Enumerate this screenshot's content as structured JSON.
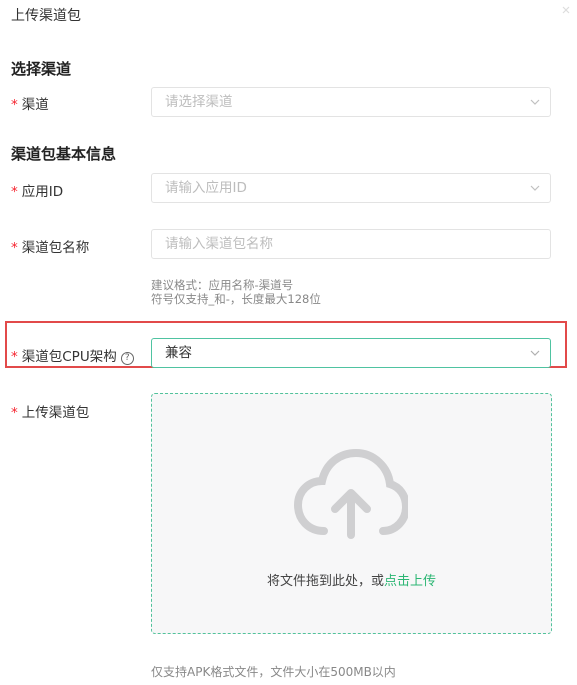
{
  "header": {
    "title": "上传渠道包"
  },
  "sections": {
    "select_channel": "选择渠道",
    "basic_info": "渠道包基本信息"
  },
  "fields": {
    "channel": {
      "required": "*",
      "label": "渠道",
      "placeholder": "请选择渠道"
    },
    "app_id": {
      "required": "*",
      "label": "应用ID",
      "placeholder": "请输入应用ID"
    },
    "package_name": {
      "required": "*",
      "label": "渠道包名称",
      "placeholder": "请输入渠道包名称",
      "hint_line1": "建议格式：应用名称-渠道号",
      "hint_line2": "符号仅支持_和-，长度最大128位"
    },
    "cpu_arch": {
      "required": "*",
      "label": "渠道包CPU架构",
      "help_glyph": "?",
      "value": "兼容"
    },
    "upload": {
      "required": "*",
      "label": "上传渠道包",
      "drop_text": "将文件拖到此处，或",
      "drop_link": "点击上传",
      "footer_hint": "仅支持APK格式文件，文件大小在500MB以内"
    }
  },
  "colors": {
    "accent": "#2bb673",
    "required": "#f5222d",
    "highlight": "#e24a4a"
  },
  "icons": {
    "close": "close-icon",
    "chevron": "chevron-down-icon",
    "help": "question-circle-icon",
    "upload": "cloud-upload-icon"
  }
}
